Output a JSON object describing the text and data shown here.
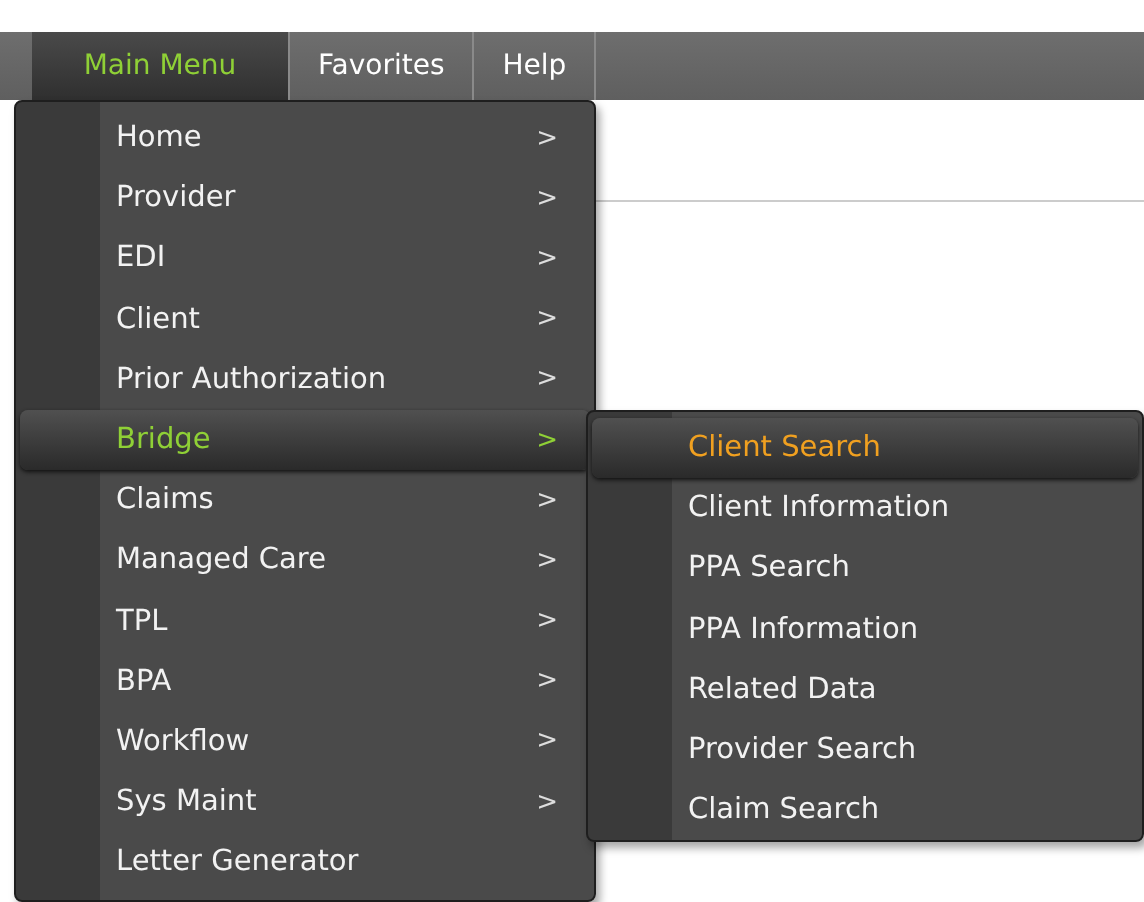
{
  "menu_bar": [
    {
      "label": "Main Menu",
      "selected": true
    },
    {
      "label": "Favorites",
      "selected": false
    },
    {
      "label": "Help",
      "selected": false
    }
  ],
  "main_menu": [
    {
      "label": "Home",
      "arrow": ">",
      "selected": false
    },
    {
      "label": "Provider",
      "arrow": ">",
      "selected": false
    },
    {
      "label": "EDI",
      "arrow": ">",
      "selected": false
    },
    {
      "label": "Client",
      "arrow": ">",
      "selected": false
    },
    {
      "label": "Prior Authorization",
      "arrow": ">",
      "selected": false
    },
    {
      "label": "Bridge",
      "arrow": ">",
      "selected": true
    },
    {
      "label": "Claims",
      "arrow": ">",
      "selected": false
    },
    {
      "label": "Managed Care",
      "arrow": ">",
      "selected": false
    },
    {
      "label": "TPL",
      "arrow": ">",
      "selected": false
    },
    {
      "label": "BPA",
      "arrow": ">",
      "selected": false
    },
    {
      "label": "Workflow",
      "arrow": ">",
      "selected": false
    },
    {
      "label": "Sys Maint",
      "arrow": ">",
      "selected": false
    },
    {
      "label": "Letter Generator",
      "selected": false
    }
  ],
  "submenu": [
    {
      "label": "Client Search",
      "selected": true
    },
    {
      "label": "Client Information",
      "selected": false
    },
    {
      "label": "PPA Search",
      "selected": false
    },
    {
      "label": "PPA Information",
      "selected": false
    },
    {
      "label": "Related Data",
      "selected": false
    },
    {
      "label": "Provider Search",
      "selected": false
    },
    {
      "label": "Claim Search",
      "selected": false
    }
  ]
}
